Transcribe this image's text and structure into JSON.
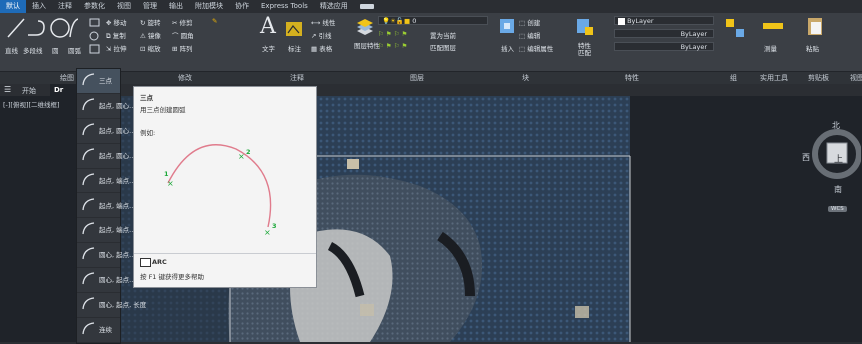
{
  "menu": {
    "tabs": [
      "默认",
      "插入",
      "注释",
      "参数化",
      "视图",
      "管理",
      "输出",
      "附加模块",
      "协作",
      "Express Tools",
      "精选应用"
    ]
  },
  "ribbon": {
    "draw": {
      "tools": [
        "直线",
        "多段线",
        "圆",
        "圆弧"
      ],
      "group": "绘图"
    },
    "modify": {
      "tools": [
        "移动",
        "旋转",
        "修剪",
        "复制",
        "镜像",
        "圆角",
        "拉伸",
        "缩放",
        "阵列"
      ],
      "group": "修改"
    },
    "annotation": {
      "text": "文字",
      "dim": "标注",
      "tools": [
        "线性",
        "引线",
        "表格"
      ],
      "group": "注释"
    },
    "layers": {
      "props": "图层特性",
      "value": "0",
      "btns": [
        "置为当前",
        "匹配图层"
      ],
      "group": "图层"
    },
    "block": {
      "insert": "插入",
      "btns": [
        "创建",
        "编辑",
        "编辑属性"
      ],
      "group": "块"
    },
    "properties": {
      "match": "特性匹配",
      "values": [
        "ByLayer",
        "ByLayer",
        "ByLayer"
      ],
      "group": "特性"
    },
    "groups": {
      "label": "组"
    },
    "utilities": {
      "label": "实用工具",
      "measure": "测量"
    },
    "clipboard": {
      "label": "剪贴板",
      "paste": "粘贴"
    },
    "view": {
      "label": "视图"
    }
  },
  "docbar": {
    "start": "开始",
    "drawing": "Dr"
  },
  "viewport": {
    "label": "[-][俯视][二维线框]"
  },
  "arc_menu": {
    "items": [
      "三点",
      "起点, 圆心...",
      "起点, 圆心...",
      "起点, 圆心...",
      "起点, 端点...",
      "起点, 端点...",
      "起点, 端点...",
      "圆心, 起点...",
      "圆心, 起点...",
      "圆心, 起点, 长度",
      "连续"
    ]
  },
  "tooltip": {
    "title": "三点",
    "desc": "用三点创建圆弧",
    "example": "例如:",
    "points": [
      "1",
      "2",
      "3"
    ],
    "command": "ARC",
    "help": "按 F1 键获得更多帮助"
  },
  "compass": {
    "north": "北",
    "south": "南",
    "west": "西",
    "top": "上",
    "wcs": "WCS"
  }
}
